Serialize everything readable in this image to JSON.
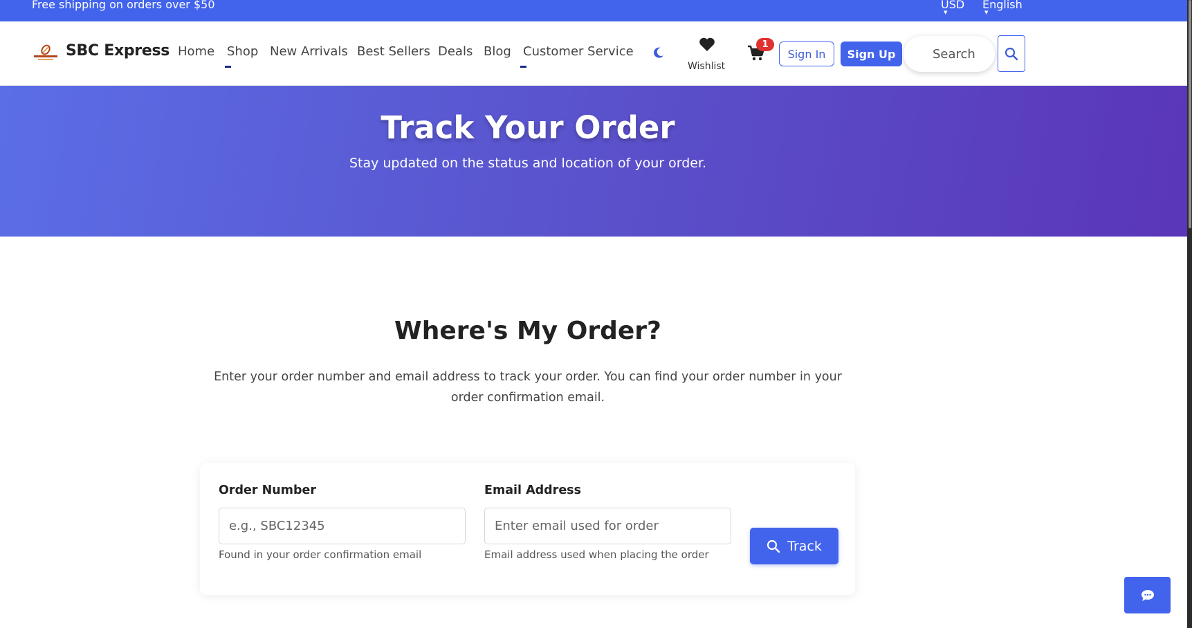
{
  "topbar": {
    "shipping_text": "Free shipping on orders over $50",
    "currency": "USD",
    "language": "English"
  },
  "brand": {
    "name": "SBC Express",
    "accent_color": "#4263eb"
  },
  "nav": {
    "links": [
      "Home",
      "Shop",
      "New Arrivals",
      "Best Sellers",
      "Deals",
      "Blog",
      "Customer Service"
    ],
    "wishlist_label": "Wishlist",
    "cart_count": "1",
    "signin_label": "Sign In",
    "signup_label": "Sign Up",
    "search_placeholder": "Search"
  },
  "hero": {
    "title": "Track Your Order",
    "subtitle": "Stay updated on the status and location of your order."
  },
  "main": {
    "title": "Where's My Order?",
    "description": "Enter your order number and email address to track your order. You can find your order number in your order confirmation email."
  },
  "form": {
    "order_label": "Order Number",
    "order_placeholder": "e.g., SBC12345",
    "order_hint": "Found in your order confirmation email",
    "email_label": "Email Address",
    "email_placeholder": "Enter email used for order",
    "email_hint": "Email address used when placing the order",
    "submit_label": "Track"
  },
  "icons": [
    "moon-icon",
    "heart-icon",
    "cart-icon",
    "search-icon",
    "chat-icon"
  ]
}
